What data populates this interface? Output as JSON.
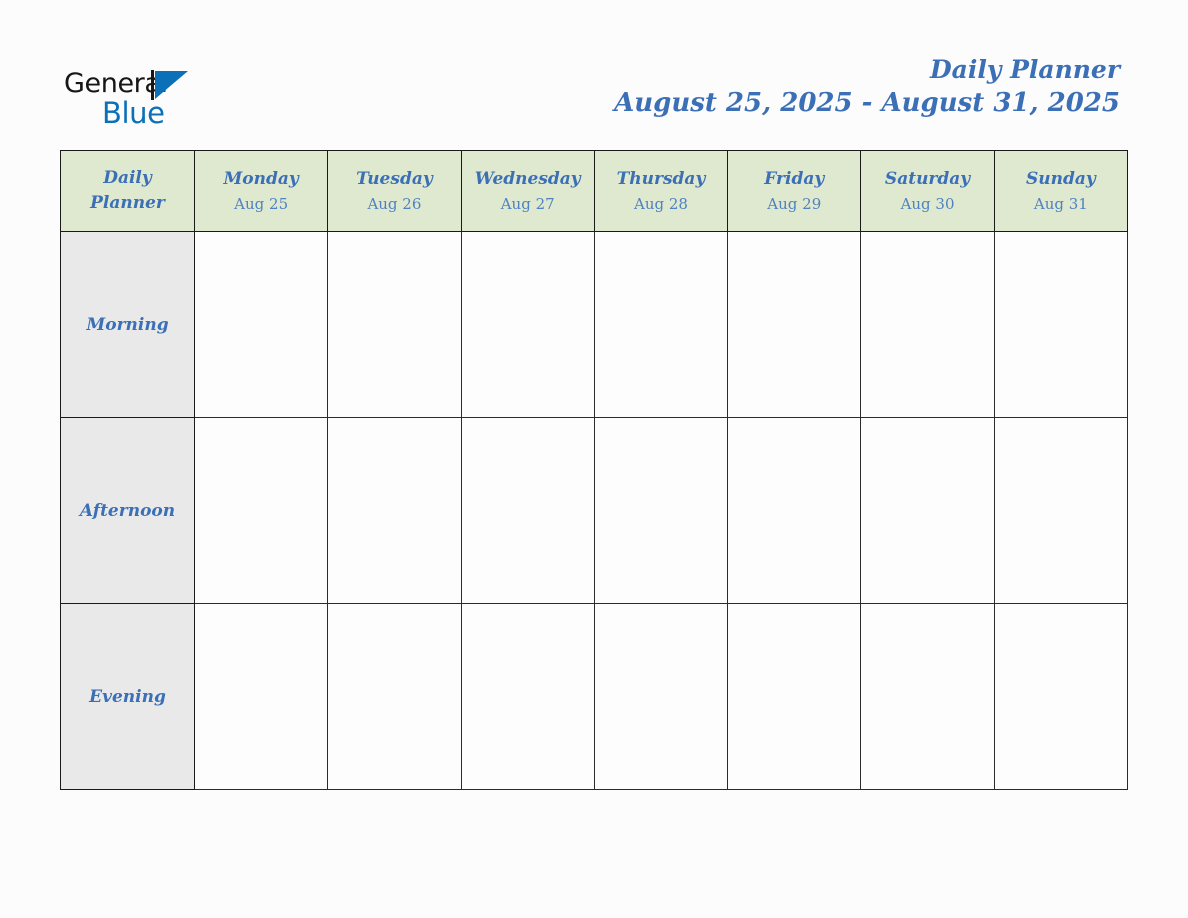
{
  "brand": {
    "name_top": "General",
    "name_bottom": "Blue",
    "triangle_icon": "blue-triangle-logo-mark",
    "colors": {
      "text_dark": "#161616",
      "blue": "#0b70b8"
    }
  },
  "header": {
    "title": "Daily Planner",
    "date_range": "August 25, 2025 - August 31, 2025"
  },
  "colors": {
    "header_green": "#dfe9d0",
    "row_label_gray": "#e9e9e9",
    "accent_blue": "#3b6fb6",
    "date_blue": "#4f82c0",
    "border": "#1a1a1a",
    "page_background": "#fcfcfd"
  },
  "table": {
    "corner_label_line1": "Daily",
    "corner_label_line2": "Planner",
    "columns": [
      {
        "day": "Monday",
        "date": "Aug 25"
      },
      {
        "day": "Tuesday",
        "date": "Aug 26"
      },
      {
        "day": "Wednesday",
        "date": "Aug 27"
      },
      {
        "day": "Thursday",
        "date": "Aug 28"
      },
      {
        "day": "Friday",
        "date": "Aug 29"
      },
      {
        "day": "Saturday",
        "date": "Aug 30"
      },
      {
        "day": "Sunday",
        "date": "Aug 31"
      }
    ],
    "rows": [
      {
        "label": "Morning",
        "cells": [
          "",
          "",
          "",
          "",
          "",
          "",
          ""
        ]
      },
      {
        "label": "Afternoon",
        "cells": [
          "",
          "",
          "",
          "",
          "",
          "",
          ""
        ]
      },
      {
        "label": "Evening",
        "cells": [
          "",
          "",
          "",
          "",
          "",
          "",
          ""
        ]
      }
    ]
  }
}
